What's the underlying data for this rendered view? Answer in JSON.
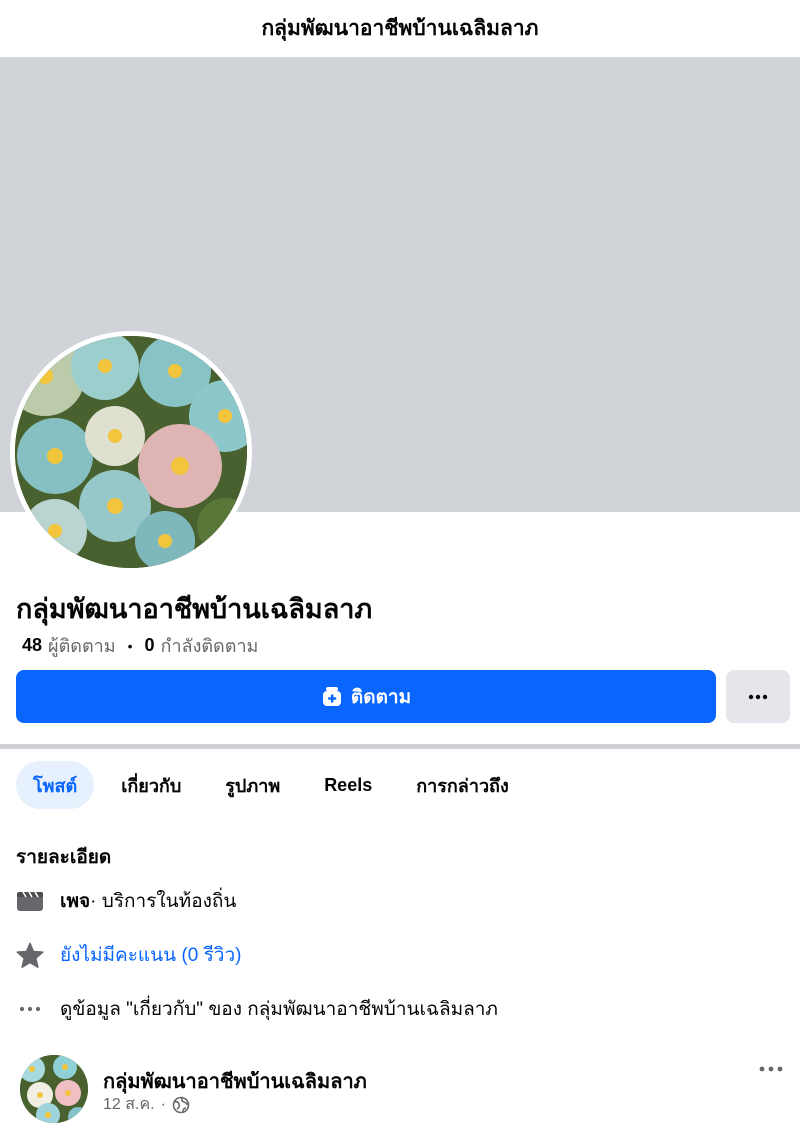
{
  "topbar": {
    "title": "กลุ่มพัฒนาอาชีพบ้านเฉลิมลาภ"
  },
  "profile": {
    "name": "กลุ่มพัฒนาอาชีพบ้านเฉลิมลาภ",
    "followers_count": "48",
    "followers_label": "ผู้ติดตาม",
    "following_count": "0",
    "following_label": "กำลังติดตาม",
    "separator": "•"
  },
  "actions": {
    "follow_label": "ติดตาม",
    "more_icon": "ellipsis-icon"
  },
  "tabs": [
    {
      "label": "โพสต์",
      "active": true
    },
    {
      "label": "เกี่ยวกับ"
    },
    {
      "label": "รูปภาพ"
    },
    {
      "label": "Reels"
    },
    {
      "label": "การกล่าวถึง"
    }
  ],
  "details": {
    "title": "รายละเอียด",
    "page_type_bold": "เพจ",
    "page_type_rest": " · บริการในท้องถิ่น",
    "rating": "ยังไม่มีคะแนน (0 รีวิว)",
    "see_about": "ดูข้อมูล \"เกี่ยวกับ\" ของ กลุ่มพัฒนาอาชีพบ้านเฉลิมลาภ"
  },
  "post": {
    "author": "กลุ่มพัฒนาอาชีพบ้านเฉลิมลาภ",
    "date": "12 ส.ค.",
    "separator": "·",
    "audience_icon": "globe-icon"
  },
  "colors": {
    "accent": "#0866ff",
    "cover": "#d0d3d7",
    "secondary_text": "#65676b"
  }
}
